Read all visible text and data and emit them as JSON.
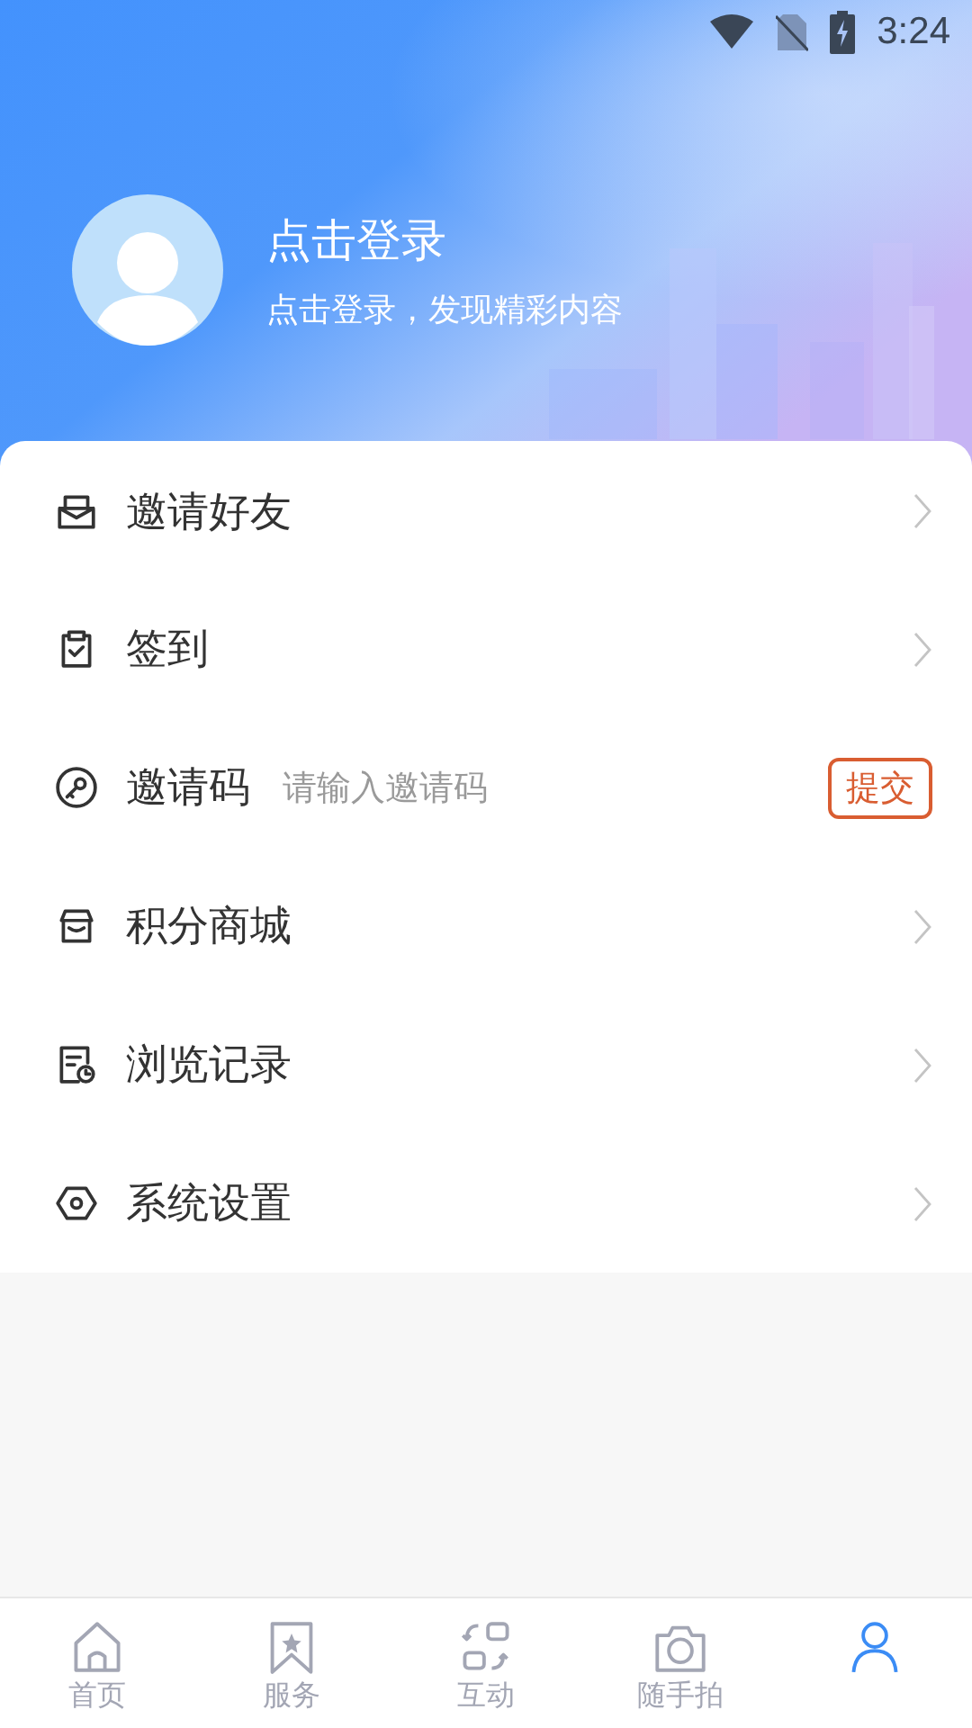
{
  "status_bar": {
    "time": "3:24"
  },
  "profile": {
    "title": "点击登录",
    "subtitle": "点击登录，发现精彩内容"
  },
  "menu": [
    {
      "kind": "link",
      "label": "邀请好友"
    },
    {
      "kind": "link",
      "label": "签到"
    },
    {
      "kind": "code",
      "label": "邀请码",
      "placeholder": "请输入邀请码",
      "button": "提交"
    },
    {
      "kind": "link",
      "label": "积分商城"
    },
    {
      "kind": "link",
      "label": "浏览记录"
    },
    {
      "kind": "link",
      "label": "系统设置"
    }
  ],
  "tabs": [
    {
      "label": "首页",
      "selected": false
    },
    {
      "label": "服务",
      "selected": false
    },
    {
      "label": "互动",
      "selected": false
    },
    {
      "label": "随手拍",
      "selected": false
    },
    {
      "selected": true
    }
  ]
}
